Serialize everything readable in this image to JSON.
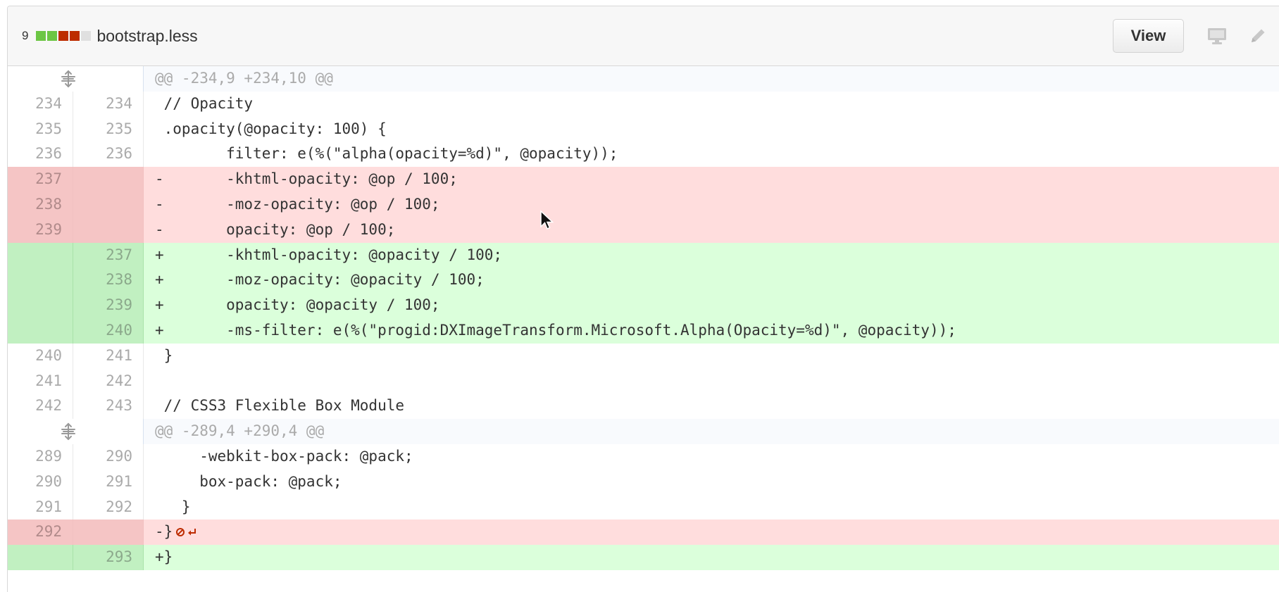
{
  "file": {
    "change_count": "9",
    "diffstat": [
      "#6cc644",
      "#6cc644",
      "#bd2c00",
      "#bd2c00",
      "#e0e0e0"
    ],
    "name": "bootstrap.less",
    "view_label": "View",
    "icons": [
      "display-icon",
      "pencil-icon"
    ]
  },
  "colors": {
    "del_bg": "#ffdddd",
    "add_bg": "#dbffdb",
    "del_gutter": "#f5c5c5",
    "add_gutter": "#c1f0c1"
  },
  "rows": [
    {
      "type": "hunk",
      "old": "",
      "new": "",
      "code": "@@ -234,9 +234,10 @@"
    },
    {
      "type": "ctx",
      "old": "234",
      "new": "234",
      "code": " // Opacity"
    },
    {
      "type": "ctx",
      "old": "235",
      "new": "235",
      "code": " .opacity(@opacity: 100) {"
    },
    {
      "type": "ctx",
      "old": "236",
      "new": "236",
      "code": "        filter: e(%(\"alpha(opacity=%d)\", @opacity));"
    },
    {
      "type": "del",
      "old": "237",
      "new": "",
      "code": "-       -khtml-opacity: @op / 100;"
    },
    {
      "type": "del",
      "old": "238",
      "new": "",
      "code": "-       -moz-opacity: @op / 100;"
    },
    {
      "type": "del",
      "old": "239",
      "new": "",
      "code": "-       opacity: @op / 100;"
    },
    {
      "type": "add",
      "old": "",
      "new": "237",
      "code": "+       -khtml-opacity: @opacity / 100;"
    },
    {
      "type": "add",
      "old": "",
      "new": "238",
      "code": "+       -moz-opacity: @opacity / 100;"
    },
    {
      "type": "add",
      "old": "",
      "new": "239",
      "code": "+       opacity: @opacity / 100;"
    },
    {
      "type": "add",
      "old": "",
      "new": "240",
      "code": "+       -ms-filter: e(%(\"progid:DXImageTransform.Microsoft.Alpha(Opacity=%d)\", @opacity));"
    },
    {
      "type": "ctx",
      "old": "240",
      "new": "241",
      "code": " }"
    },
    {
      "type": "ctx",
      "old": "241",
      "new": "242",
      "code": ""
    },
    {
      "type": "ctx",
      "old": "242",
      "new": "243",
      "code": " // CSS3 Flexible Box Module"
    },
    {
      "type": "hunk",
      "old": "",
      "new": "",
      "code": "@@ -289,4 +290,4 @@"
    },
    {
      "type": "ctx",
      "old": "289",
      "new": "290",
      "code": "     -webkit-box-pack: @pack;"
    },
    {
      "type": "ctx",
      "old": "290",
      "new": "291",
      "code": "     box-pack: @pack;"
    },
    {
      "type": "ctx",
      "old": "291",
      "new": "292",
      "code": "   }"
    },
    {
      "type": "del",
      "old": "292",
      "new": "",
      "code": "-}",
      "noeol": true
    },
    {
      "type": "add",
      "old": "",
      "new": "293",
      "code": "+}"
    }
  ]
}
